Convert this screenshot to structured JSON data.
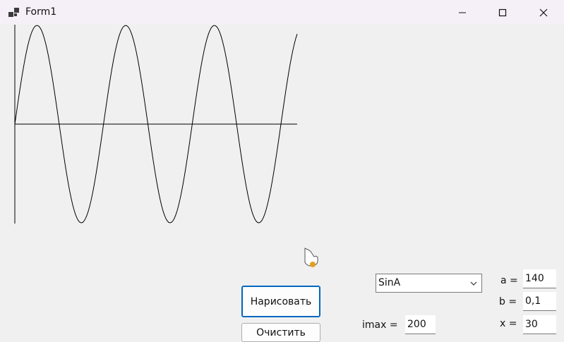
{
  "window": {
    "title": "Form1",
    "icons": {
      "app": "app-icon",
      "minimize": "minimize-icon",
      "maximize": "maximize-icon",
      "close": "close-icon"
    }
  },
  "plot": {
    "function": "sin",
    "line_color": "#000000"
  },
  "buttons": {
    "draw_label": "Нарисовать",
    "clear_label": "Очистить"
  },
  "function_select": {
    "selected": "SinA"
  },
  "params": {
    "a_label": "a =",
    "a_value": "140",
    "b_label": "b =",
    "b_value": "0,1",
    "x_label": "x =",
    "x_value": "30",
    "imax_label": "imax =",
    "imax_value": "200"
  }
}
